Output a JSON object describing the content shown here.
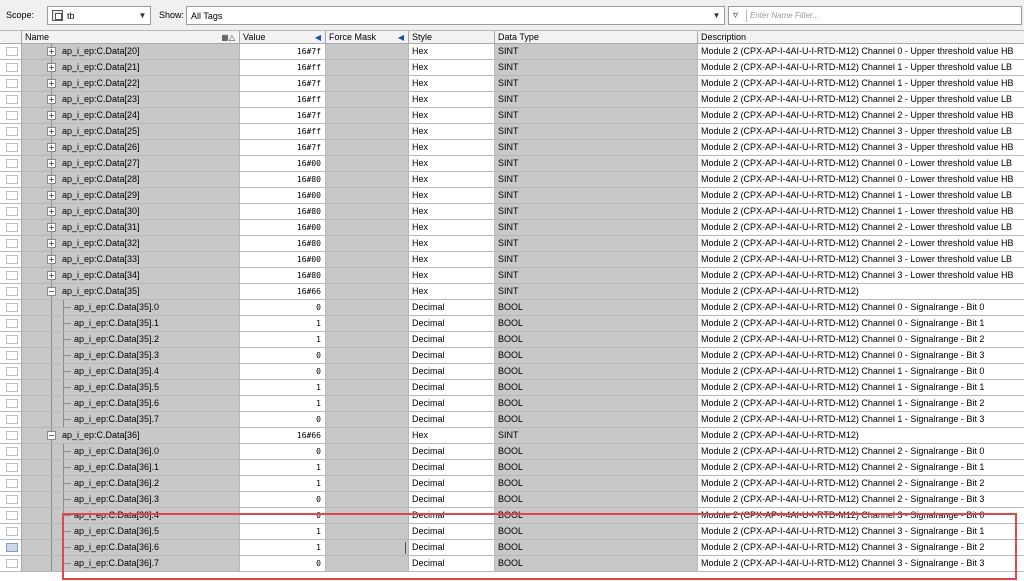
{
  "toolbar": {
    "scope_label": "Scope:",
    "scope_value": "tb",
    "show_label": "Show:",
    "show_value": "All Tags",
    "filter_placeholder": "Enter Name Filter..."
  },
  "columns": {
    "name": "Name",
    "value": "Value",
    "force_mask": "Force Mask",
    "style": "Style",
    "data_type": "Data Type",
    "description": "Description"
  },
  "rows": [
    {
      "level": 1,
      "expander": "+",
      "name": "ap_i_ep:C.Data[20]",
      "value": "16#7f",
      "style": "Hex",
      "type": "SINT",
      "desc": "Module 2 (CPX-AP-I-4AI-U-I-RTD-M12) Channel 0 - Upper threshold value HB"
    },
    {
      "level": 1,
      "expander": "+",
      "name": "ap_i_ep:C.Data[21]",
      "value": "16#ff",
      "style": "Hex",
      "type": "SINT",
      "desc": "Module 2 (CPX-AP-I-4AI-U-I-RTD-M12) Channel 1 - Upper threshold value LB"
    },
    {
      "level": 1,
      "expander": "+",
      "name": "ap_i_ep:C.Data[22]",
      "value": "16#7f",
      "style": "Hex",
      "type": "SINT",
      "desc": "Module 2 (CPX-AP-I-4AI-U-I-RTD-M12) Channel 1 - Upper threshold value HB"
    },
    {
      "level": 1,
      "expander": "+",
      "name": "ap_i_ep:C.Data[23]",
      "value": "16#ff",
      "style": "Hex",
      "type": "SINT",
      "desc": "Module 2 (CPX-AP-I-4AI-U-I-RTD-M12) Channel 2 - Upper threshold value LB"
    },
    {
      "level": 1,
      "expander": "+",
      "name": "ap_i_ep:C.Data[24]",
      "value": "16#7f",
      "style": "Hex",
      "type": "SINT",
      "desc": "Module 2 (CPX-AP-I-4AI-U-I-RTD-M12) Channel 2 - Upper threshold value HB"
    },
    {
      "level": 1,
      "expander": "+",
      "name": "ap_i_ep:C.Data[25]",
      "value": "16#ff",
      "style": "Hex",
      "type": "SINT",
      "desc": "Module 2 (CPX-AP-I-4AI-U-I-RTD-M12) Channel 3 - Upper threshold value LB"
    },
    {
      "level": 1,
      "expander": "+",
      "name": "ap_i_ep:C.Data[26]",
      "value": "16#7f",
      "style": "Hex",
      "type": "SINT",
      "desc": "Module 2 (CPX-AP-I-4AI-U-I-RTD-M12) Channel 3 - Upper threshold value HB"
    },
    {
      "level": 1,
      "expander": "+",
      "name": "ap_i_ep:C.Data[27]",
      "value": "16#00",
      "style": "Hex",
      "type": "SINT",
      "desc": "Module 2 (CPX-AP-I-4AI-U-I-RTD-M12) Channel 0 - Lower threshold value LB"
    },
    {
      "level": 1,
      "expander": "+",
      "name": "ap_i_ep:C.Data[28]",
      "value": "16#80",
      "style": "Hex",
      "type": "SINT",
      "desc": "Module 2 (CPX-AP-I-4AI-U-I-RTD-M12) Channel 0 - Lower threshold value HB"
    },
    {
      "level": 1,
      "expander": "+",
      "name": "ap_i_ep:C.Data[29]",
      "value": "16#00",
      "style": "Hex",
      "type": "SINT",
      "desc": "Module 2 (CPX-AP-I-4AI-U-I-RTD-M12) Channel 1 - Lower threshold value LB"
    },
    {
      "level": 1,
      "expander": "+",
      "name": "ap_i_ep:C.Data[30]",
      "value": "16#80",
      "style": "Hex",
      "type": "SINT",
      "desc": "Module 2 (CPX-AP-I-4AI-U-I-RTD-M12) Channel 1 - Lower threshold value HB"
    },
    {
      "level": 1,
      "expander": "+",
      "name": "ap_i_ep:C.Data[31]",
      "value": "16#00",
      "style": "Hex",
      "type": "SINT",
      "desc": "Module 2 (CPX-AP-I-4AI-U-I-RTD-M12) Channel 2 - Lower threshold value LB"
    },
    {
      "level": 1,
      "expander": "+",
      "name": "ap_i_ep:C.Data[32]",
      "value": "16#80",
      "style": "Hex",
      "type": "SINT",
      "desc": "Module 2 (CPX-AP-I-4AI-U-I-RTD-M12) Channel 2 - Lower threshold value HB"
    },
    {
      "level": 1,
      "expander": "+",
      "name": "ap_i_ep:C.Data[33]",
      "value": "16#00",
      "style": "Hex",
      "type": "SINT",
      "desc": "Module 2 (CPX-AP-I-4AI-U-I-RTD-M12) Channel 3 - Lower threshold value LB"
    },
    {
      "level": 1,
      "expander": "+",
      "name": "ap_i_ep:C.Data[34]",
      "value": "16#80",
      "style": "Hex",
      "type": "SINT",
      "desc": "Module 2 (CPX-AP-I-4AI-U-I-RTD-M12) Channel 3 - Lower threshold value HB"
    },
    {
      "level": 1,
      "expander": "−",
      "name": "ap_i_ep:C.Data[35]",
      "value": "16#66",
      "style": "Hex",
      "type": "SINT",
      "desc": "Module 2 (CPX-AP-I-4AI-U-I-RTD-M12)"
    },
    {
      "level": 2,
      "expander": "",
      "name": "ap_i_ep:C.Data[35].0",
      "value": "0",
      "style": "Decimal",
      "type": "BOOL",
      "desc": "Module 2 (CPX-AP-I-4AI-U-I-RTD-M12) Channel 0 - Signalrange - Bit 0"
    },
    {
      "level": 2,
      "expander": "",
      "name": "ap_i_ep:C.Data[35].1",
      "value": "1",
      "style": "Decimal",
      "type": "BOOL",
      "desc": "Module 2 (CPX-AP-I-4AI-U-I-RTD-M12) Channel 0 - Signalrange - Bit 1"
    },
    {
      "level": 2,
      "expander": "",
      "name": "ap_i_ep:C.Data[35].2",
      "value": "1",
      "style": "Decimal",
      "type": "BOOL",
      "desc": "Module 2 (CPX-AP-I-4AI-U-I-RTD-M12) Channel 0 - Signalrange - Bit 2"
    },
    {
      "level": 2,
      "expander": "",
      "name": "ap_i_ep:C.Data[35].3",
      "value": "0",
      "style": "Decimal",
      "type": "BOOL",
      "desc": "Module 2 (CPX-AP-I-4AI-U-I-RTD-M12) Channel 0 - Signalrange - Bit 3"
    },
    {
      "level": 2,
      "expander": "",
      "name": "ap_i_ep:C.Data[35].4",
      "value": "0",
      "style": "Decimal",
      "type": "BOOL",
      "desc": "Module 2 (CPX-AP-I-4AI-U-I-RTD-M12) Channel 1 - Signalrange - Bit 0"
    },
    {
      "level": 2,
      "expander": "",
      "name": "ap_i_ep:C.Data[35].5",
      "value": "1",
      "style": "Decimal",
      "type": "BOOL",
      "desc": "Module 2 (CPX-AP-I-4AI-U-I-RTD-M12) Channel 1 - Signalrange - Bit 1"
    },
    {
      "level": 2,
      "expander": "",
      "name": "ap_i_ep:C.Data[35].6",
      "value": "1",
      "style": "Decimal",
      "type": "BOOL",
      "desc": "Module 2 (CPX-AP-I-4AI-U-I-RTD-M12) Channel 1 - Signalrange - Bit 2"
    },
    {
      "level": 2,
      "expander": "",
      "name": "ap_i_ep:C.Data[35].7",
      "value": "0",
      "style": "Decimal",
      "type": "BOOL",
      "desc": "Module 2 (CPX-AP-I-4AI-U-I-RTD-M12) Channel 1 - Signalrange - Bit 3"
    },
    {
      "level": 1,
      "expander": "−",
      "name": "ap_i_ep:C.Data[36]",
      "value": "16#66",
      "style": "Hex",
      "type": "SINT",
      "desc": "Module 2 (CPX-AP-I-4AI-U-I-RTD-M12)"
    },
    {
      "level": 2,
      "expander": "",
      "name": "ap_i_ep:C.Data[36].0",
      "value": "0",
      "style": "Decimal",
      "type": "BOOL",
      "desc": "Module 2 (CPX-AP-I-4AI-U-I-RTD-M12) Channel 2 - Signalrange - Bit 0"
    },
    {
      "level": 2,
      "expander": "",
      "name": "ap_i_ep:C.Data[36].1",
      "value": "1",
      "style": "Decimal",
      "type": "BOOL",
      "desc": "Module 2 (CPX-AP-I-4AI-U-I-RTD-M12) Channel 2 - Signalrange - Bit 1"
    },
    {
      "level": 2,
      "expander": "",
      "name": "ap_i_ep:C.Data[36].2",
      "value": "1",
      "style": "Decimal",
      "type": "BOOL",
      "desc": "Module 2 (CPX-AP-I-4AI-U-I-RTD-M12) Channel 2 - Signalrange - Bit 2"
    },
    {
      "level": 2,
      "expander": "",
      "name": "ap_i_ep:C.Data[36].3",
      "value": "0",
      "style": "Decimal",
      "type": "BOOL",
      "desc": "Module 2 (CPX-AP-I-4AI-U-I-RTD-M12) Channel 2 - Signalrange - Bit 3"
    },
    {
      "level": 2,
      "expander": "",
      "name": "ap_i_ep:C.Data[36].4",
      "value": "0",
      "style": "Decimal",
      "type": "BOOL",
      "desc": "Module 2 (CPX-AP-I-4AI-U-I-RTD-M12) Channel 3 - Signalrange - Bit 0"
    },
    {
      "level": 2,
      "expander": "",
      "name": "ap_i_ep:C.Data[36].5",
      "value": "1",
      "style": "Decimal",
      "type": "BOOL",
      "desc": "Module 2 (CPX-AP-I-4AI-U-I-RTD-M12) Channel 3 - Signalrange - Bit 1"
    },
    {
      "level": 2,
      "expander": "",
      "name": "ap_i_ep:C.Data[36].6",
      "value": "1",
      "style": "Decimal",
      "type": "BOOL",
      "desc": "Module 2 (CPX-AP-I-4AI-U-I-RTD-M12) Channel 3 - Signalrange - Bit 2",
      "current": true
    },
    {
      "level": 2,
      "expander": "",
      "name": "ap_i_ep:C.Data[36].7",
      "value": "0",
      "style": "Decimal",
      "type": "BOOL",
      "desc": "Module 2 (CPX-AP-I-4AI-U-I-RTD-M12) Channel 3 - Signalrange - Bit 3"
    }
  ],
  "colors": {
    "highlight_box": "#e0474c",
    "readonly_column": "#c8c8c8",
    "header_sort_icon": "#1a4fb5"
  },
  "icons": {
    "scope": "controller-icon",
    "filter": "filter-icon",
    "sort": "sort-arrow-icon",
    "expand": "expand-plus-icon",
    "collapse": "collapse-minus-icon"
  }
}
